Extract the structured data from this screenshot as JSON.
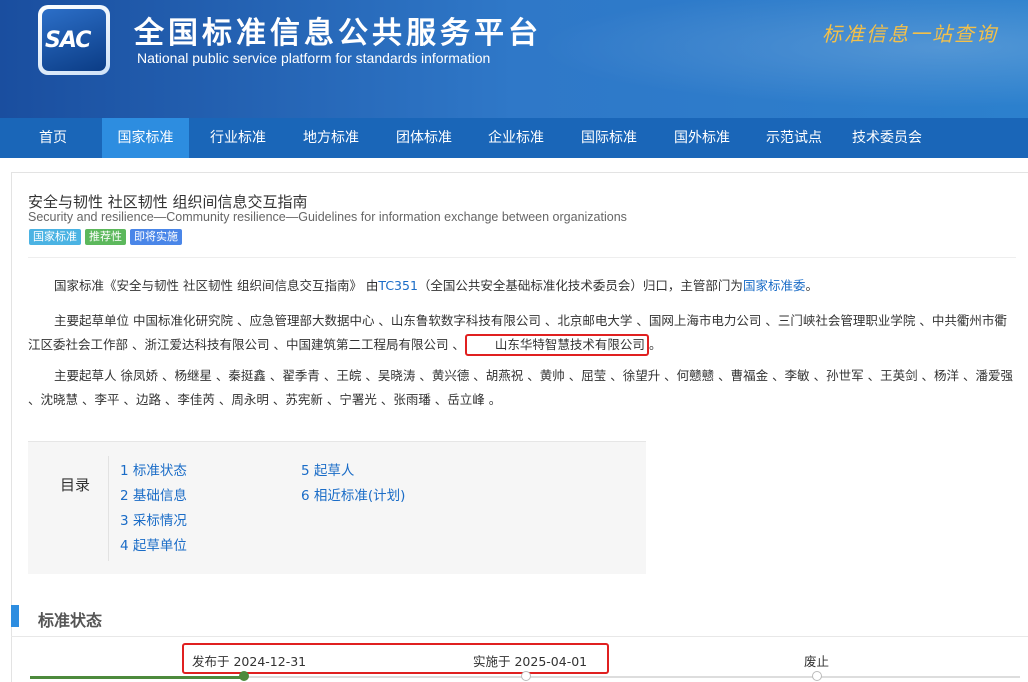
{
  "header": {
    "logo_text": "SAC",
    "title_cn": "全国标准信息公共服务平台",
    "title_en": "National public service platform  for standards information",
    "slogan": "标准信息一站查询"
  },
  "nav": {
    "items": [
      "首页",
      "国家标准",
      "行业标准",
      "地方标准",
      "团体标准",
      "企业标准",
      "国际标准",
      "国外标准",
      "示范试点",
      "技术委员会"
    ],
    "active_index": 1
  },
  "standard": {
    "title_cn": "安全与韧性 社区韧性 组织间信息交互指南",
    "title_en": "Security and resilience—Community resilience—Guidelines for information exchange between organizations",
    "tags": [
      {
        "label": "国家标准",
        "color": "#4bb3e3"
      },
      {
        "label": "推荐性",
        "color": "#5cb85c"
      },
      {
        "label": "即将实施",
        "color": "#4a86e8"
      }
    ]
  },
  "intro": {
    "p1_prefix": "国家标准《安全与韧性 社区韧性 组织间信息交互指南》 由",
    "p1_tc": "TC351",
    "p1_mid": "（全国公共安全基础标准化技术委员会）归口，主管部门为",
    "p1_dept": "国家标准委",
    "p1_suffix": "。",
    "p2_text": "主要起草单位 中国标准化研究院 、应急管理部大数据中心 、山东鲁软数字科技有限公司 、北京邮电大学 、国网上海市电力公司 、三门峡社会管理职业学院 、中共衢州市衢江区委社会工作部 、浙江爱达科技有限公司 、中国建筑第二工程局有限公司 、",
    "p2_highlight": "山东华特智慧技术有限公司",
    "p2_suffix": "。",
    "p3_text": "主要起草人 徐凤娇 、杨继星 、秦挺鑫 、翟季青 、王皖 、吴晓涛 、黄兴德 、胡燕祝 、黄帅 、屈莹 、徐望升 、何戆戆 、曹福金 、李敏 、孙世军 、王英剑 、杨洋 、潘爱强 、沈晓慧 、李平 、边路 、李佳芮 、周永明 、苏宪新 、宁署光 、张雨璠 、岳立峰 。"
  },
  "toc": {
    "label": "目录",
    "items": [
      "1  标准状态",
      "2  基础信息",
      "3  采标情况",
      "4  起草单位",
      "5  起草人",
      "6  相近标准(计划)"
    ]
  },
  "status_section": {
    "title": "标准状态",
    "published": "发布于 2024-12-31",
    "effective": "实施于 2025-04-01",
    "abolished": "废止"
  }
}
